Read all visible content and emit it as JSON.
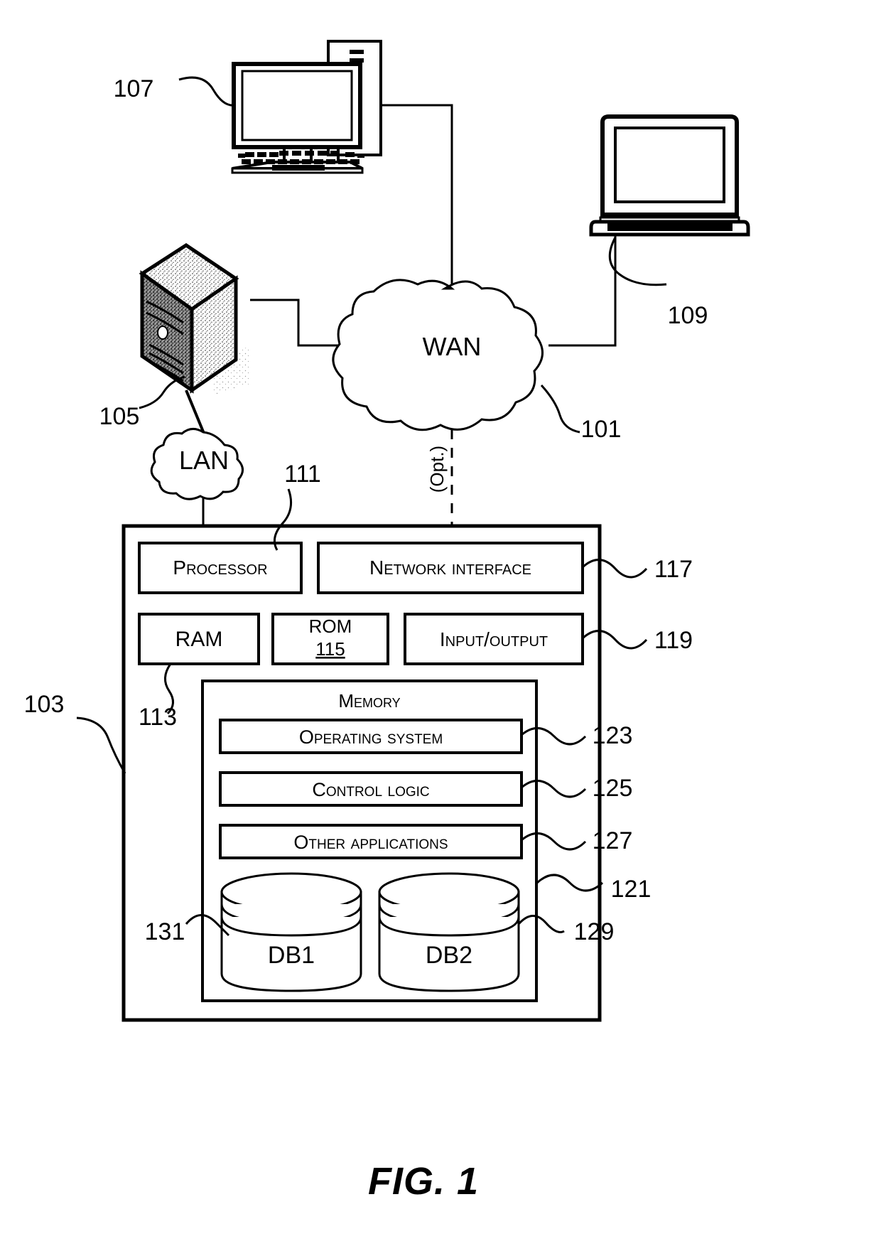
{
  "figure": {
    "caption": "FIG. 1",
    "type": "patent-block-diagram"
  },
  "nodes": {
    "desktop_computer": {
      "ref": "107",
      "icon": "desktop-computer-icon"
    },
    "laptop": {
      "ref": "109",
      "icon": "laptop-icon"
    },
    "server_tower": {
      "ref": "105",
      "icon": "server-tower-icon"
    },
    "wan_cloud": {
      "ref": "101",
      "label": "WAN",
      "icon": "cloud-icon"
    },
    "lan_cloud": {
      "label": "LAN",
      "icon": "cloud-icon"
    },
    "computing_device": {
      "ref": "103"
    }
  },
  "connections": {
    "optional_link_label": "(Opt.)"
  },
  "device_blocks": {
    "processor": {
      "label": "Processor",
      "ref": "111"
    },
    "network_interface": {
      "label": "Network interface",
      "ref": "117"
    },
    "ram": {
      "label": "RAM",
      "ref": "113"
    },
    "rom": {
      "label": "ROM",
      "ref": "115"
    },
    "input_output": {
      "label": "Input/output",
      "ref": "119"
    },
    "memory": {
      "label": "Memory",
      "ref": "121"
    },
    "operating_system": {
      "label": "Operating system",
      "ref": "123"
    },
    "control_logic": {
      "label": "Control logic",
      "ref": "125"
    },
    "other_applications": {
      "label": "Other applications",
      "ref": "127"
    },
    "db1": {
      "label": "DB1",
      "ref": "131"
    },
    "db2": {
      "label": "DB2",
      "ref": "129"
    }
  },
  "colors": {
    "stroke": "#000000",
    "background": "#ffffff"
  }
}
